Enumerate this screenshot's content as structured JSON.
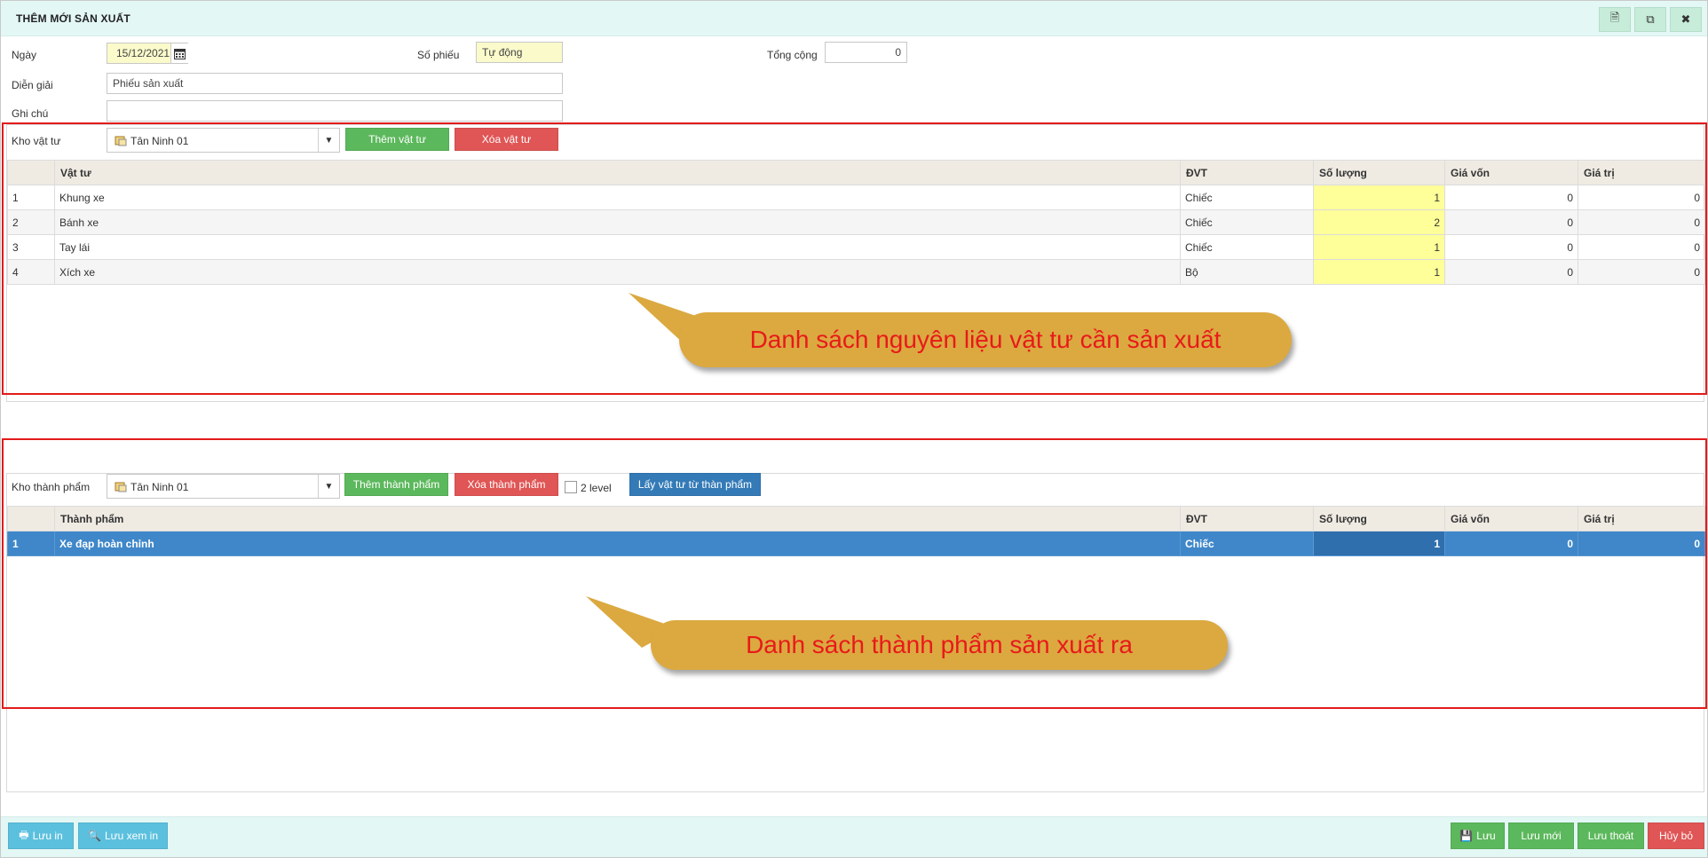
{
  "window": {
    "title": "THÊM MỚI SẢN XUẤT",
    "buttons": [
      {
        "icon": "document-icon",
        "glyph": "🗎"
      },
      {
        "icon": "copy-icon",
        "glyph": "⧉"
      },
      {
        "icon": "close-icon",
        "glyph": "✖"
      }
    ]
  },
  "form": {
    "date_label": "Ngày",
    "date_value": "15/12/2021",
    "voucher_label": "Số phiếu",
    "voucher_value": "Tự động",
    "total_label": "Tổng cộng",
    "total_value": "0",
    "description_label": "Diễn giải",
    "description_value": "Phiếu sản xuất",
    "note_label": "Ghi chú",
    "note_value": ""
  },
  "materials": {
    "warehouse_label": "Kho vật tư",
    "warehouse_value": "Tân Ninh 01",
    "add_button": "Thêm vật tư",
    "delete_button": "Xóa vật tư",
    "columns": [
      "",
      "Vật tư",
      "ĐVT",
      "Số lượng",
      "Giá vốn",
      "Giá trị"
    ],
    "rows": [
      {
        "no": "1",
        "name": "Khung xe",
        "unit": "Chiếc",
        "qty": "1",
        "cost": "0",
        "value": "0"
      },
      {
        "no": "2",
        "name": "Bánh xe",
        "unit": "Chiếc",
        "qty": "2",
        "cost": "0",
        "value": "0"
      },
      {
        "no": "3",
        "name": "Tay lái",
        "unit": "Chiếc",
        "qty": "1",
        "cost": "0",
        "value": "0"
      },
      {
        "no": "4",
        "name": "Xích xe",
        "unit": "Bộ",
        "qty": "1",
        "cost": "0",
        "value": "0"
      }
    ],
    "callout": "Danh sách nguyên liệu vật tư cần sản xuất"
  },
  "products": {
    "warehouse_label": "Kho thành phẩm",
    "warehouse_value": "Tân Ninh 01",
    "add_button": "Thêm thành phẩm",
    "delete_button": "Xóa thành phẩm",
    "level_label": "2 level",
    "fetch_button": "Lấy vật tư từ thàn phẩm",
    "columns": [
      "",
      "Thành phẩm",
      "ĐVT",
      "Số lượng",
      "Giá vốn",
      "Giá trị"
    ],
    "rows": [
      {
        "no": "1",
        "name": "Xe đạp hoàn chỉnh",
        "unit": "Chiếc",
        "qty": "1",
        "cost": "0",
        "value": "0"
      }
    ],
    "callout": "Danh sách thành phẩm sản xuất ra"
  },
  "footer": {
    "print_save": "Lưu in",
    "preview_save": "Lưu xem in",
    "save": "Lưu",
    "save_new": "Lưu mới",
    "save_exit": "Lưu thoát",
    "cancel": "Hủy bỏ"
  },
  "colors": {
    "header_bg": "#e3f7f5",
    "highlight_border": "#e31b1b",
    "callout_bg": "#dba940",
    "callout_text": "#e81a1a",
    "selected_row": "#3f87c9"
  }
}
